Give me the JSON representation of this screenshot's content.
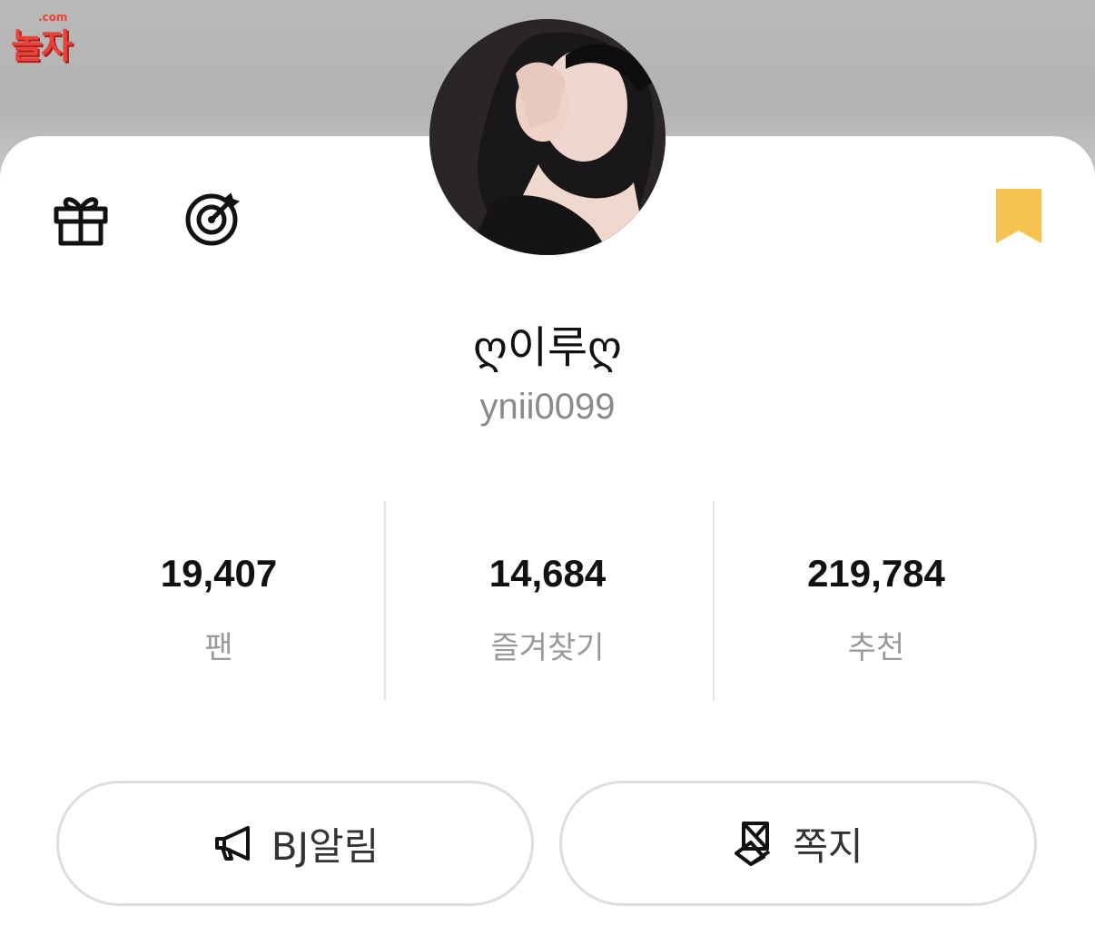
{
  "watermark": {
    "top": ".com",
    "main": "놀자"
  },
  "profile": {
    "name": "ღ이루ღ",
    "user_id": "ynii0099"
  },
  "icons": {
    "gift": "gift-icon",
    "target": "target-icon",
    "bookmark": "bookmark-icon",
    "megaphone": "megaphone-icon",
    "message": "message-icon"
  },
  "stats": [
    {
      "value": "19,407",
      "label": "팬"
    },
    {
      "value": "14,684",
      "label": "즐겨찾기"
    },
    {
      "value": "219,784",
      "label": "추천"
    }
  ],
  "buttons": {
    "alarm_label": "BJ알림",
    "message_label": "쪽지"
  },
  "colors": {
    "accent": "#f5c350",
    "watermark": "#e8423a",
    "cover": "#b6b6b6",
    "label_gray": "#9a9a9a"
  }
}
